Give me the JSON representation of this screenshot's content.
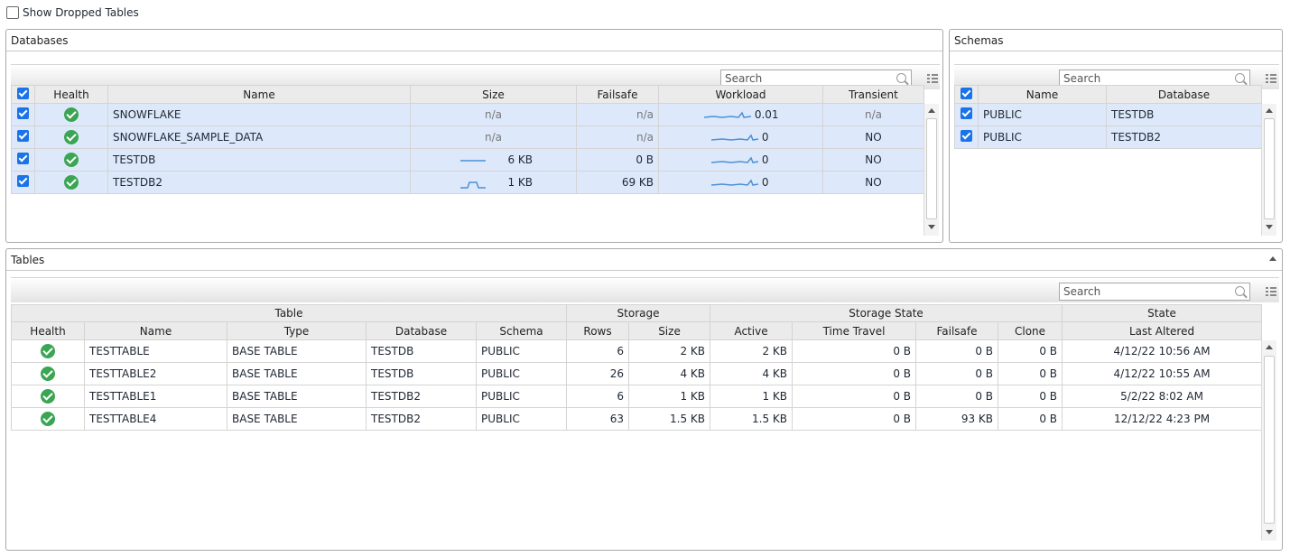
{
  "show_dropped": {
    "label": "Show Dropped Tables",
    "checked": false
  },
  "databases": {
    "title": "Databases",
    "search_placeholder": "Search",
    "headers": [
      "Health",
      "Name",
      "Size",
      "Failsafe",
      "Workload",
      "Transient"
    ],
    "rows": [
      {
        "name": "SNOWFLAKE",
        "size": "n/a",
        "failsafe": "n/a",
        "workload": "0.01",
        "transient": "n/a"
      },
      {
        "name": "SNOWFLAKE_SAMPLE_DATA",
        "size": "n/a",
        "failsafe": "n/a",
        "workload": "0",
        "transient": "NO"
      },
      {
        "name": "TESTDB",
        "size": "6 KB",
        "failsafe": "0 B",
        "workload": "0",
        "transient": "NO"
      },
      {
        "name": "TESTDB2",
        "size": "1 KB",
        "failsafe": "69 KB",
        "workload": "0",
        "transient": "NO"
      }
    ]
  },
  "schemas": {
    "title": "Schemas",
    "search_placeholder": "Search",
    "headers": [
      "Name",
      "Database"
    ],
    "rows": [
      {
        "name": "PUBLIC",
        "database": "TESTDB"
      },
      {
        "name": "PUBLIC",
        "database": "TESTDB2"
      }
    ]
  },
  "tables": {
    "title": "Tables",
    "search_placeholder": "Search",
    "groups": [
      "Table",
      "Storage",
      "Storage State",
      "State"
    ],
    "headers": [
      "Health",
      "Name",
      "Type",
      "Database",
      "Schema",
      "Rows",
      "Size",
      "Active",
      "Time Travel",
      "Failsafe",
      "Clone",
      "Last Altered"
    ],
    "rows": [
      {
        "name": "TESTTABLE",
        "type": "BASE TABLE",
        "database": "TESTDB",
        "schema": "PUBLIC",
        "rows": "6",
        "size": "2 KB",
        "active": "2 KB",
        "time_travel": "0 B",
        "failsafe": "0 B",
        "clone": "0 B",
        "last_altered": "4/12/22 10:56 AM"
      },
      {
        "name": "TESTTABLE2",
        "type": "BASE TABLE",
        "database": "TESTDB",
        "schema": "PUBLIC",
        "rows": "26",
        "size": "4 KB",
        "active": "4 KB",
        "time_travel": "0 B",
        "failsafe": "0 B",
        "clone": "0 B",
        "last_altered": "4/12/22 10:55 AM"
      },
      {
        "name": "TESTTABLE1",
        "type": "BASE TABLE",
        "database": "TESTDB2",
        "schema": "PUBLIC",
        "rows": "6",
        "size": "1 KB",
        "active": "1 KB",
        "time_travel": "0 B",
        "failsafe": "0 B",
        "clone": "0 B",
        "last_altered": "5/2/22 8:02 AM"
      },
      {
        "name": "TESTTABLE4",
        "type": "BASE TABLE",
        "database": "TESTDB2",
        "schema": "PUBLIC",
        "rows": "63",
        "size": "1.5 KB",
        "active": "1.5 KB",
        "time_travel": "0 B",
        "failsafe": "93 KB",
        "clone": "0 B",
        "last_altered": "12/12/22 4:23 PM"
      }
    ]
  },
  "colors": {
    "accent": "#1a73e8",
    "health_ok": "#3aa552",
    "selected_row": "#dde9fa",
    "sparkline": "#4a90d9"
  },
  "icons": [
    "checkbox-icon",
    "health-ok-icon",
    "search-icon",
    "column-chooser-icon",
    "scroll-up-icon",
    "scroll-down-icon",
    "collapse-icon"
  ]
}
